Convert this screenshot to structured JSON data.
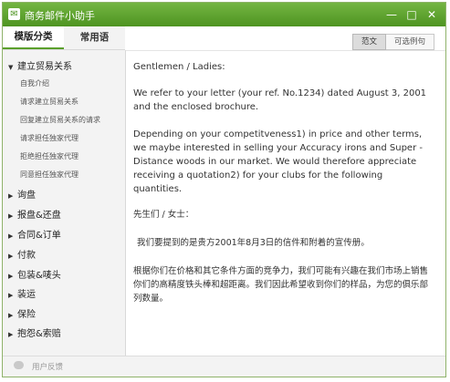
{
  "app": {
    "title": "商务邮件小助手"
  },
  "window_controls": {
    "minimize": "—",
    "maximize": "□",
    "close": "✕"
  },
  "tabs": [
    {
      "label": "模版分类",
      "active": true
    },
    {
      "label": "常用语",
      "active": false
    }
  ],
  "sidebar": {
    "expanded_category": {
      "label": "建立贸易关系",
      "items": [
        "自我介绍",
        "请求建立贸易关系",
        "回复建立贸易关系的请求",
        "请求担任独家代理",
        "拒绝担任独家代理",
        "同意担任独家代理"
      ]
    },
    "categories": [
      "询盘",
      "报盘&还盘",
      "合同&订单",
      "付款",
      "包装&唛头",
      "装运",
      "保险",
      "抱怨&索赔"
    ]
  },
  "view_toggle": {
    "sample": "范文",
    "options": "可选例句",
    "active": "sample"
  },
  "letter": {
    "salutation": "Gentlemen / Ladies:",
    "p1": "We refer to your letter (your ref. No.1234) dated August 3, 2001 and the enclosed brochure.",
    "p2": "Depending on your competitveness1) in price and other terms, we maybe interested in selling your Accuracy irons and Super - Distance woods in our market. We would therefore appreciate receiving a quotation2) for your clubs for the following quantities.",
    "cn_salutation": "先生们 / 女士：",
    "cn_p1": "我们要提到的是贵方2001年8月3日的信件和附着的宣传册。",
    "cn_p2": "根据你们在价格和其它条件方面的竞争力，我们可能有兴趣在我们市场上销售你们的高精度铁头棒和超距离。我们因此希望收到你们的样品，为您的俱乐部列数量。"
  },
  "statusbar": {
    "feedback": "用户反馈"
  },
  "colors": {
    "titlebar": "#5a9f2c",
    "accent": "#5a9f2c"
  }
}
